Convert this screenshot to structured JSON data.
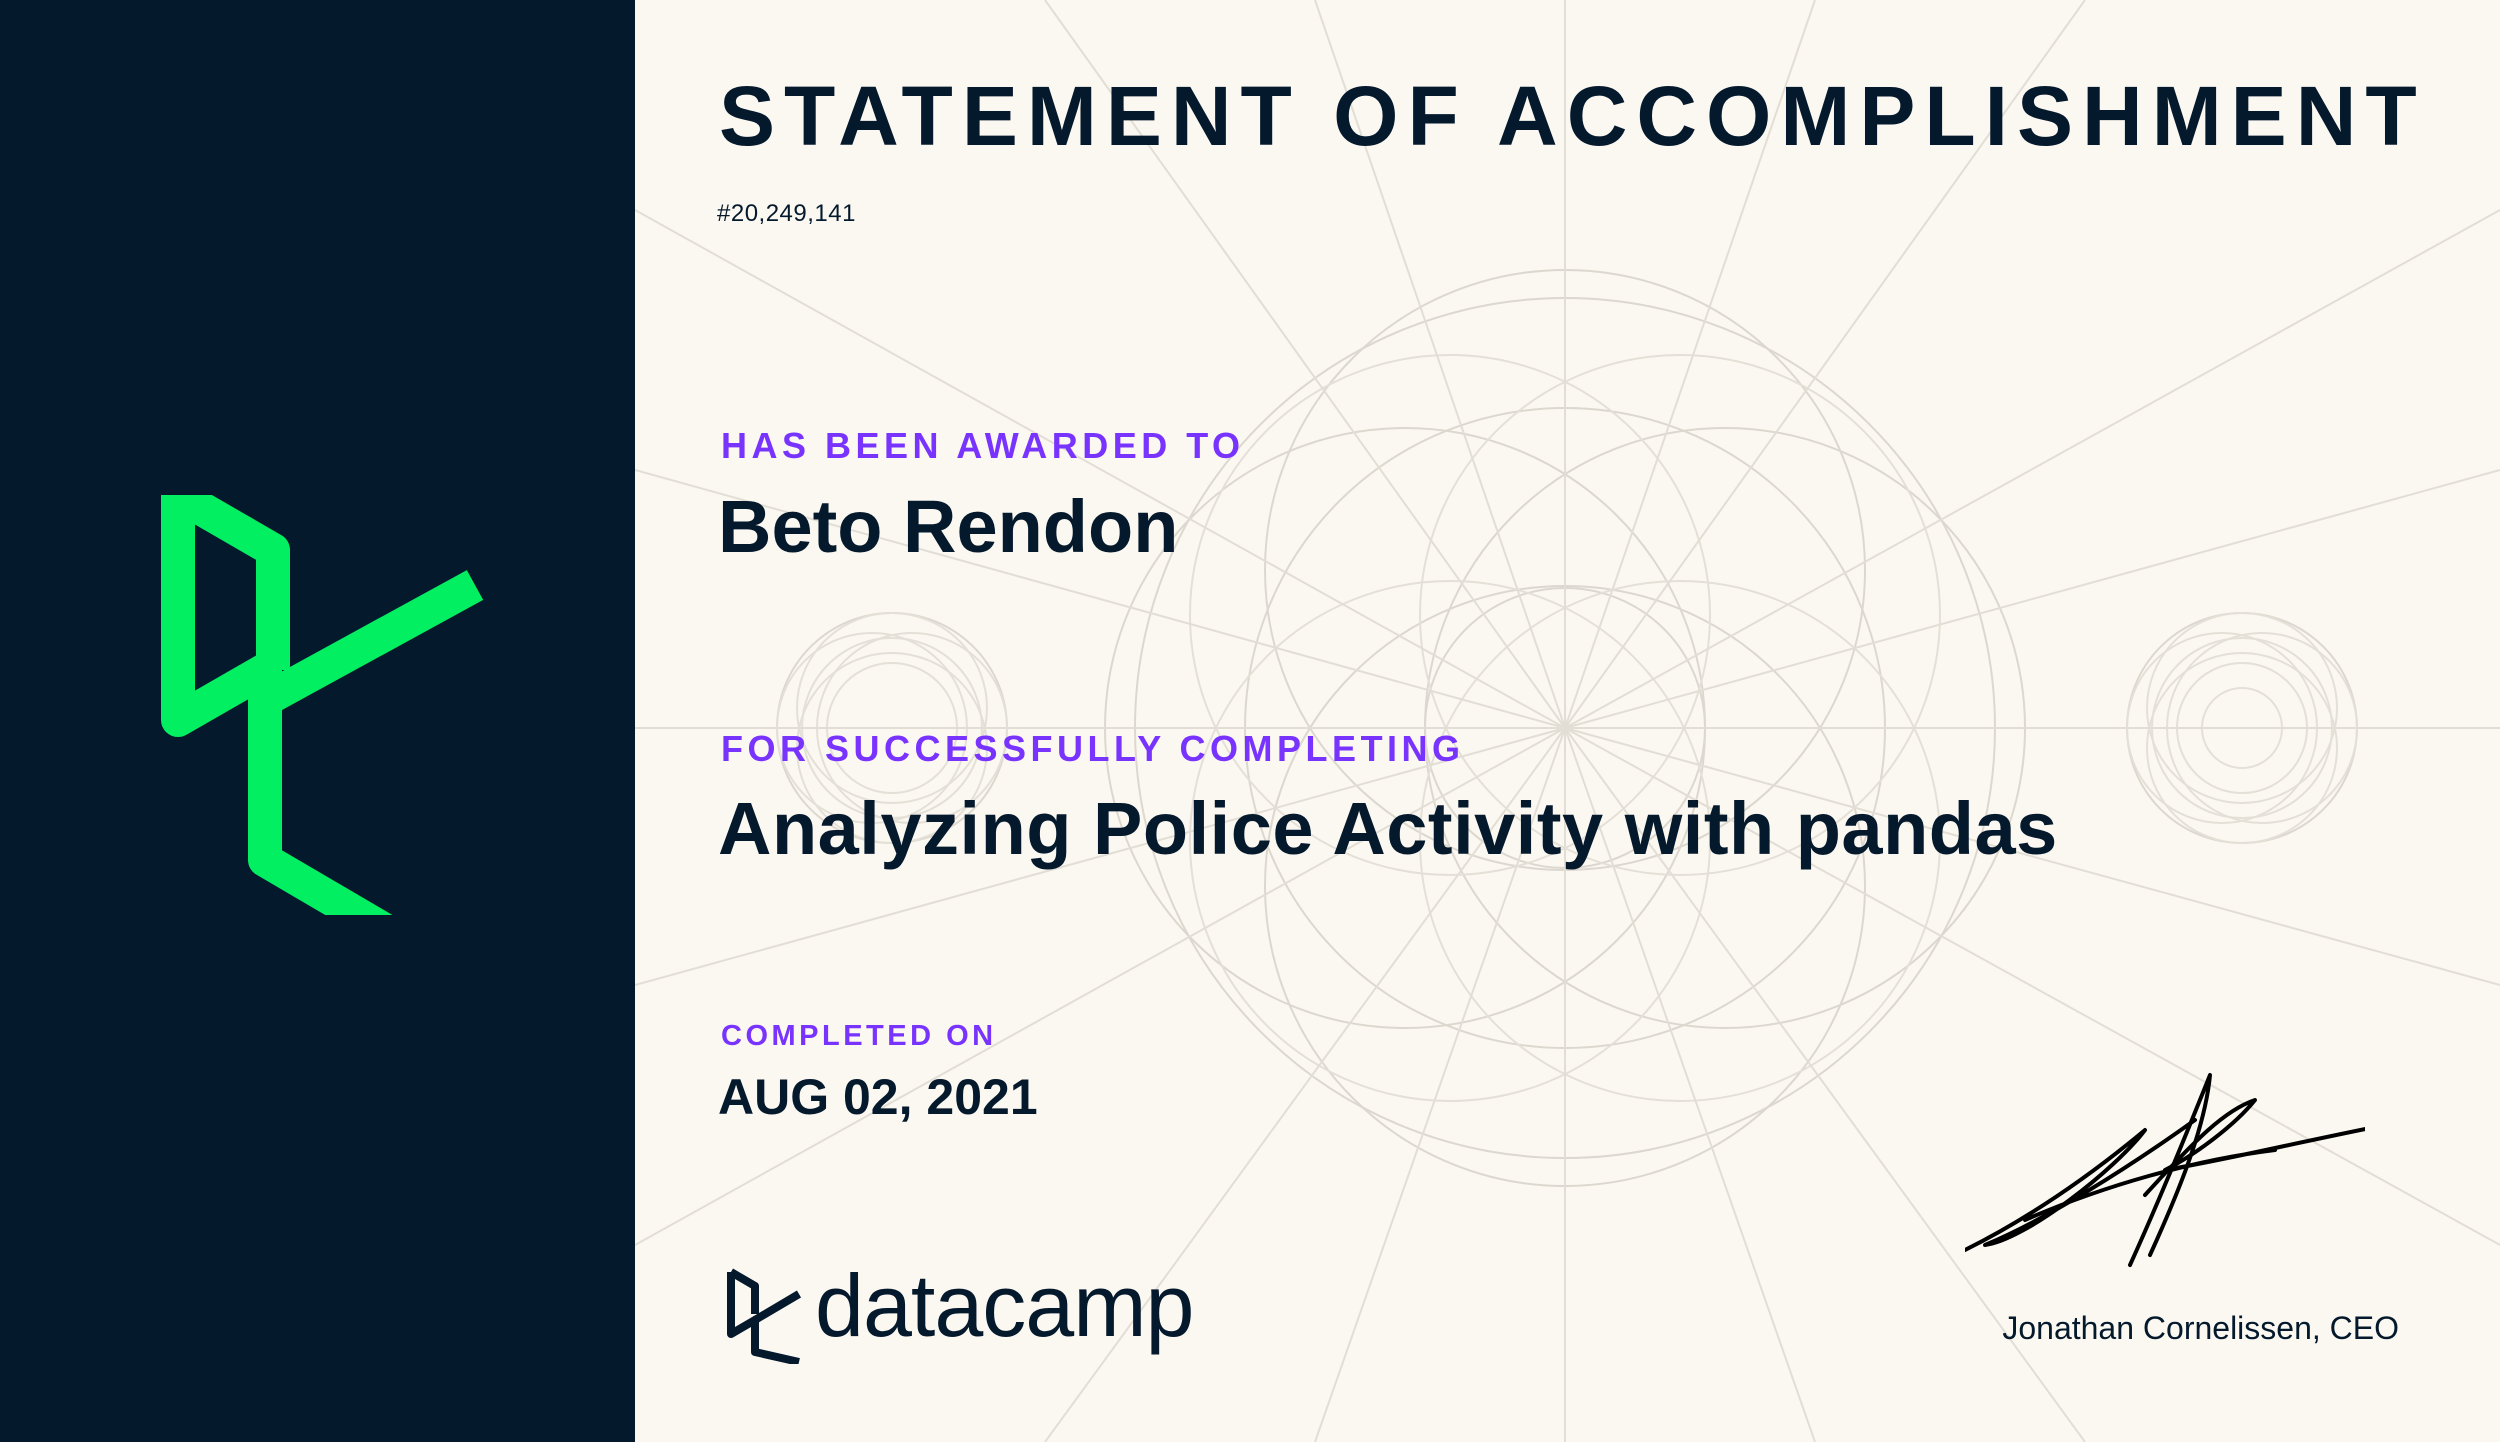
{
  "certificate": {
    "title": "STATEMENT OF ACCOMPLISHMENT",
    "id": "#20,249,141",
    "awarded_label": "HAS BEEN AWARDED TO",
    "recipient": "Beto Rendon",
    "completing_label": "FOR SUCCESSFULLY COMPLETING",
    "course": "Analyzing Police Activity with pandas",
    "completed_label": "COMPLETED ON",
    "completed_date": "AUG 02, 2021"
  },
  "brand": {
    "name": "datacamp",
    "logo_icon": "datacamp-logo-icon",
    "accent_color": "#03ef62",
    "label_color": "#7933ff",
    "navy_color": "#05192d"
  },
  "signature": {
    "signer": "Jonathan Cornelissen, CEO"
  }
}
